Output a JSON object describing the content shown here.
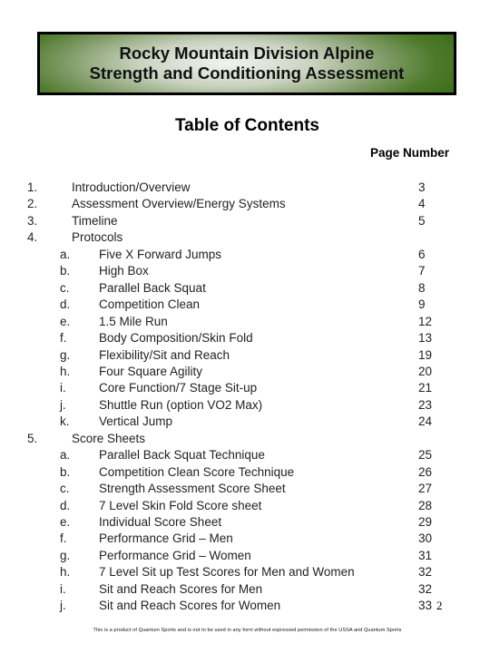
{
  "banner": {
    "line1": "Rocky Mountain Division Alpine",
    "line2": "Strength and Conditioning Assessment",
    "colors": {
      "border": "#000000",
      "green": "#3f6f1c",
      "center": "#f2f4f0"
    }
  },
  "toc": {
    "title": "Table of Contents",
    "page_number_header": "Page Number",
    "entries": [
      {
        "level": "top",
        "num": "1.",
        "label": "Introduction/Overview",
        "page": "3"
      },
      {
        "level": "top",
        "num": "2.",
        "label": "Assessment Overview/Energy Systems",
        "page": "4"
      },
      {
        "level": "top",
        "num": "3.",
        "label": "Timeline",
        "page": "5"
      },
      {
        "level": "top",
        "num": "4.",
        "label": "Protocols",
        "page": ""
      },
      {
        "level": "sub",
        "num": "a.",
        "label": "Five X Forward Jumps",
        "page": "6"
      },
      {
        "level": "sub",
        "num": "b.",
        "label": "High Box",
        "page": "7"
      },
      {
        "level": "sub",
        "num": "c.",
        "label": "Parallel Back Squat",
        "page": "8"
      },
      {
        "level": "sub",
        "num": "d.",
        "label": "Competition Clean",
        "page": "9"
      },
      {
        "level": "sub",
        "num": "e.",
        "label": "1.5 Mile Run",
        "page": "12"
      },
      {
        "level": "sub",
        "num": "f.",
        "label": "Body Composition/Skin Fold",
        "page": "13"
      },
      {
        "level": "sub",
        "num": "g.",
        "label": "Flexibility/Sit and Reach",
        "page": "19"
      },
      {
        "level": "sub",
        "num": "h.",
        "label": "Four Square Agility",
        "page": "20"
      },
      {
        "level": "sub",
        "num": "i.",
        "label": "Core Function/7 Stage Sit-up",
        "page": "21"
      },
      {
        "level": "sub",
        "num": "j.",
        "label": "Shuttle Run (option VO2 Max)",
        "page": "23"
      },
      {
        "level": "sub",
        "num": "k.",
        "label": "Vertical Jump",
        "page": "24"
      },
      {
        "level": "top",
        "num": "5.",
        "label": "Score Sheets",
        "page": ""
      },
      {
        "level": "sub",
        "num": "a.",
        "label": "Parallel Back Squat Technique",
        "page": "25"
      },
      {
        "level": "sub",
        "num": "b.",
        "label": "Competition Clean Score Technique",
        "page": "26"
      },
      {
        "level": "sub",
        "num": "c.",
        "label": "Strength Assessment Score Sheet",
        "page": "27"
      },
      {
        "level": "sub",
        "num": "d.",
        "label": "7 Level Skin Fold Score sheet",
        "page": "28"
      },
      {
        "level": "sub",
        "num": "e.",
        "label": "Individual Score Sheet",
        "page": "29"
      },
      {
        "level": "sub",
        "num": "f.",
        "label": "Performance Grid – Men",
        "page": "30"
      },
      {
        "level": "sub",
        "num": "g.",
        "label": "Performance Grid – Women",
        "page": "31"
      },
      {
        "level": "sub",
        "num": "h.",
        "label": "7 Level Sit up Test Scores for Men and Women",
        "page": "32"
      },
      {
        "level": "sub",
        "num": "i.",
        "label": "Sit and Reach Scores for Men",
        "page": "32"
      },
      {
        "level": "sub",
        "num": "j.",
        "label": "Sit and Reach Scores for Women",
        "page": "33"
      }
    ]
  },
  "document_page_number": "2",
  "footer": "This is a product of Quantum Sports and is not to be used in any form without expressed permission of the USSA and Quantum Sports"
}
